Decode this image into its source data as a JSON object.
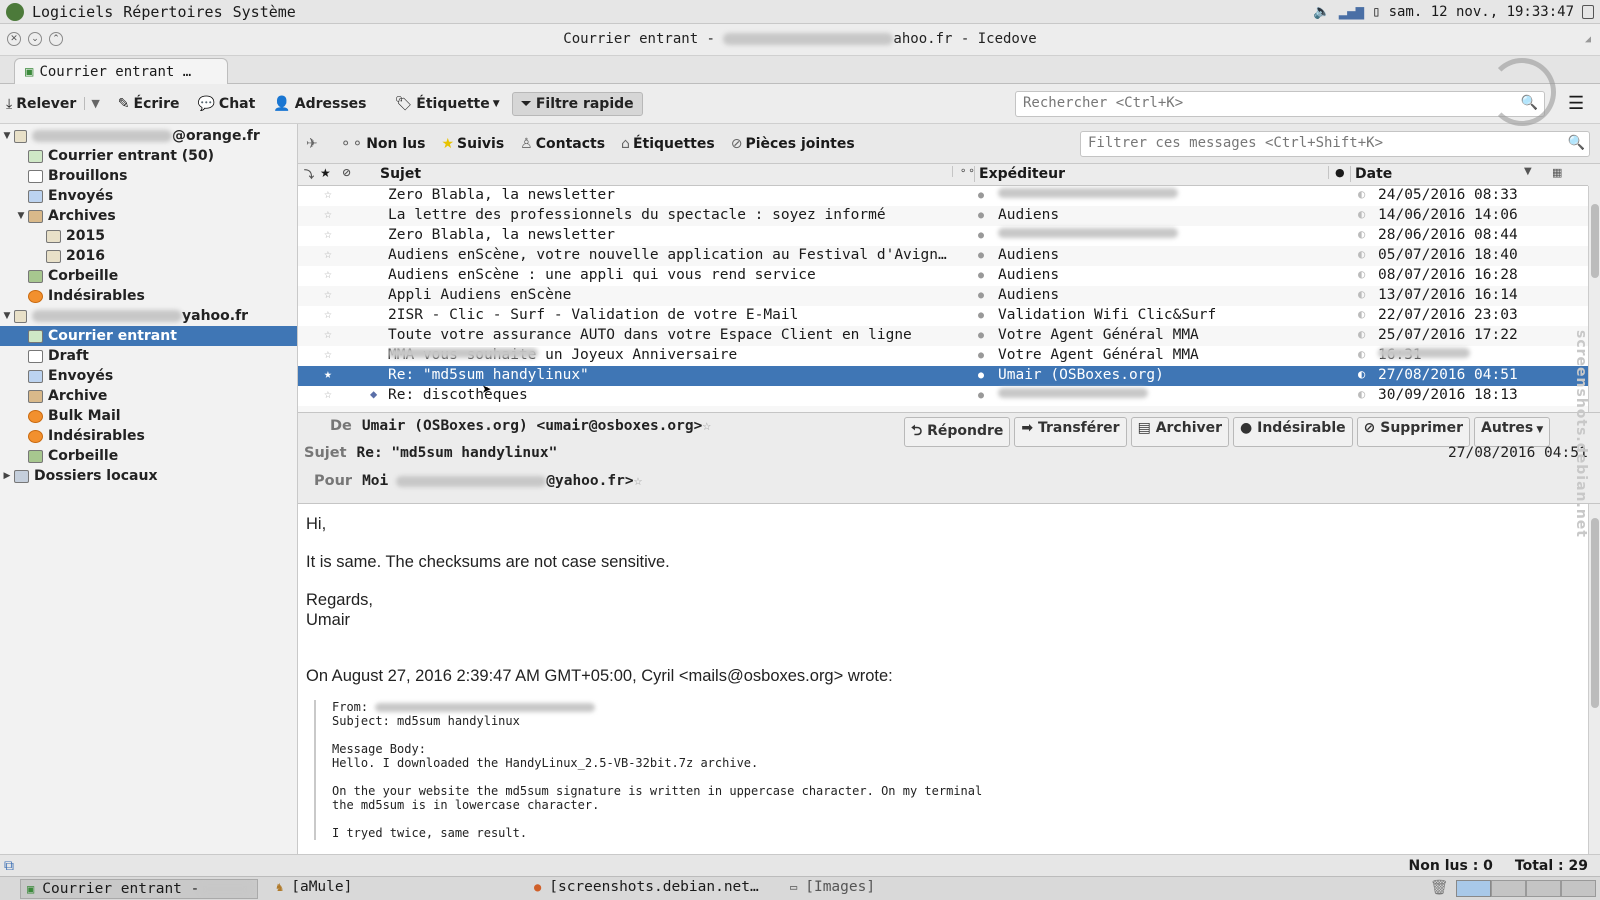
{
  "system_panel": {
    "menus": [
      "Logiciels",
      "Répertoires",
      "Système"
    ],
    "clock": "sam. 12 nov., 19:33:47"
  },
  "window": {
    "title_prefix": "Courrier entrant - ",
    "title_suffix": "ahoo.fr - Icedove"
  },
  "tabs": [
    {
      "label": "Courrier entrant …"
    }
  ],
  "toolbar": {
    "get_label": "Relever",
    "write_label": "Écrire",
    "chat_label": "Chat",
    "addresses_label": "Adresses",
    "tag_label": "Étiquette",
    "quickfilter_label": "Filtre rapide",
    "search_placeholder": "Rechercher <Ctrl+K>"
  },
  "folders": {
    "account1": "@orange.fr",
    "account1_items": [
      "Courrier entrant (50)",
      "Brouillons",
      "Envoyés",
      "Archives",
      "2015",
      "2016",
      "Corbeille",
      "Indésirables"
    ],
    "account2": "yahoo.fr",
    "account2_items": [
      "Courrier entrant",
      "Draft",
      "Envoyés",
      "Archive",
      "Bulk Mail",
      "Indésirables",
      "Corbeille"
    ],
    "local": "Dossiers locaux"
  },
  "quickfilter": {
    "unread": "Non lus",
    "starred": "Suivis",
    "contacts": "Contacts",
    "tags": "Étiquettes",
    "attachments": "Pièces jointes",
    "filter_placeholder": "Filtrer ces messages <Ctrl+Shift+K>"
  },
  "columns": {
    "subject": "Sujet",
    "sender": "Expéditeur",
    "date": "Date"
  },
  "messages": [
    {
      "subject": "Zero Blabla, la newsletter",
      "sender": "",
      "date": "24/05/2016 08:33"
    },
    {
      "subject": "La lettre des professionnels du spectacle : soyez informé",
      "sender": "Audiens",
      "date": "14/06/2016 14:06"
    },
    {
      "subject": "Zero Blabla, la newsletter",
      "sender": "",
      "date": "28/06/2016 08:44"
    },
    {
      "subject": "Audiens enScène, votre nouvelle application au Festival d'Avignon",
      "sender": "Audiens",
      "date": "05/07/2016 18:40"
    },
    {
      "subject": "Audiens enScène : une appli qui vous rend service",
      "sender": "Audiens",
      "date": "08/07/2016 16:28"
    },
    {
      "subject": "Appli Audiens enScène",
      "sender": "Audiens",
      "date": "13/07/2016 16:14"
    },
    {
      "subject": "2ISR - Clic - Surf - Validation de votre E-Mail",
      "sender": "Validation Wifi Clic&Surf",
      "date": "22/07/2016 23:03"
    },
    {
      "subject": "Toute votre assurance AUTO dans votre Espace Client en ligne",
      "sender": "Votre Agent Général MMA",
      "date": "25/07/2016 17:22"
    },
    {
      "subject": "MMA vous souhaite un Joyeux Anniversaire",
      "sender": "Votre Agent Général MMA",
      "date": "16:31"
    },
    {
      "subject": "Re: \"md5sum handylinux\"",
      "sender": "Umair (OSBoxes.org)",
      "date": "27/08/2016 04:51"
    },
    {
      "subject": "Re: discothèques",
      "sender": "",
      "date": "30/09/2016 18:13"
    }
  ],
  "header": {
    "from_label": "De",
    "from_value": "Umair (OSBoxes.org) <umair@osboxes.org>",
    "subject_label": "Sujet",
    "subject_value": "Re: \"md5sum handylinux\"",
    "to_label": "Pour",
    "to_value": "Moi",
    "to_suffix": "@yahoo.fr>",
    "date": "27/08/2016 04:51",
    "buttons": {
      "reply": "Répondre",
      "forward": "Transférer",
      "archive": "Archiver",
      "junk": "Indésirable",
      "delete": "Supprimer",
      "other": "Autres"
    }
  },
  "body": {
    "greeting": "Hi,",
    "line1": "It is same. The checksums are not case sensitive.",
    "closing": "Regards,",
    "signature": "Umair",
    "attribution": "On August 27, 2016 2:39:47 AM GMT+05:00, Cyril <mails@osboxes.org> wrote:",
    "quote_from": "From:",
    "quote_subject": "Subject: md5sum handylinux",
    "quote_body_label": "Message Body:",
    "quote_l1": "Hello. I downloaded the HandyLinux_2.5-VB-32bit.7z archive.",
    "quote_l2": "On the your website the md5sum signature is written in uppercase character. On my terminal",
    "quote_l3": "the md5sum is in lowercase character.",
    "quote_l4": "I tryed twice, same result."
  },
  "status": {
    "unread": "Non lus : 0",
    "total": "Total : 29"
  },
  "taskbar": {
    "t1": "Courrier entrant - ",
    "t2": "[aMule]",
    "t3": "[screenshots.debian.net…",
    "t4": "[Images]"
  },
  "watermark": "screenshots.debian.net"
}
